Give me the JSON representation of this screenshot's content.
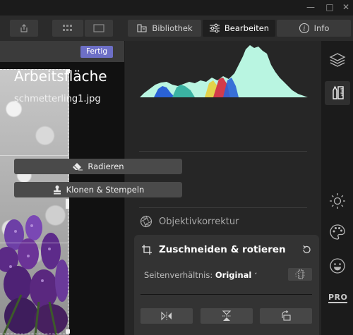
{
  "toolbar": {
    "library_label": "Bibliothek",
    "edit_label": "Bearbeiten",
    "info_label": "Info"
  },
  "image": {
    "done_label": "Fertig"
  },
  "panel": {
    "title": "Arbeitsfläche",
    "filename": "schmetterling1.jpg",
    "erase_label": "Radieren",
    "clone_label": "Klonen & Stempeln",
    "lens_label": "Objektivkorrektur",
    "crop": {
      "title": "Zuschneiden & rotieren",
      "aspect_label": "Seitenverhältnis:",
      "aspect_value": "Original"
    }
  },
  "rail": {
    "pro_label": "PRO"
  },
  "colors": {
    "accent": "#6d6fc6",
    "histogram_main": "#b9f5e1",
    "histogram_blue": "#2a62d6",
    "histogram_red": "#d23b4b",
    "histogram_yellow": "#e3d24a"
  }
}
